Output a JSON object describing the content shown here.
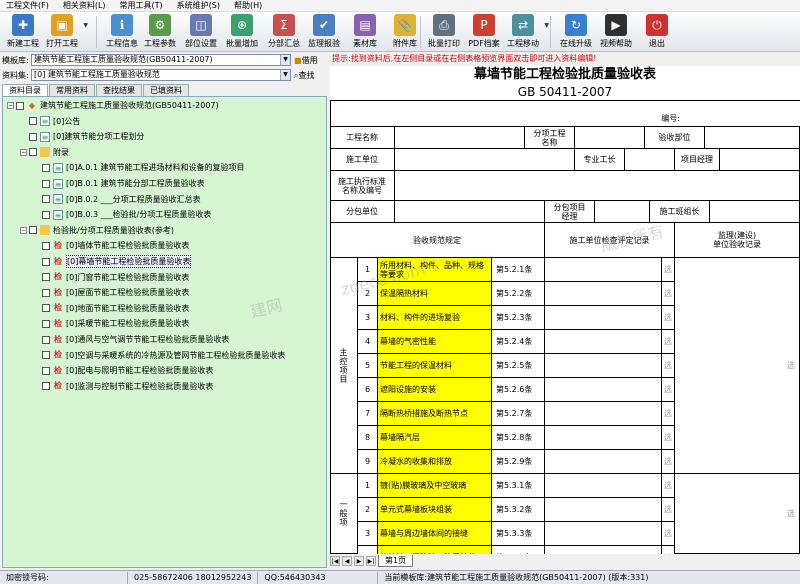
{
  "menu": [
    "工程文件(F)",
    "相关资料(L)",
    "常用工具(T)",
    "系统维护(S)",
    "帮助(H)"
  ],
  "toolbar": [
    {
      "label": "新建工程",
      "icon": "new-project-icon",
      "color": "#3a78c8"
    },
    {
      "label": "打开工程",
      "icon": "open-project-icon",
      "color": "#e0a020"
    },
    {
      "label": "工程信息",
      "icon": "project-info-icon",
      "color": "#4a90d0"
    },
    {
      "label": "工程参数",
      "icon": "project-params-icon",
      "color": "#5a9a4a"
    },
    {
      "label": "部位设置",
      "icon": "position-settings-icon",
      "color": "#6a7ab0"
    },
    {
      "label": "批量增加",
      "icon": "batch-add-icon",
      "color": "#3aa070"
    },
    {
      "label": "分部汇总",
      "icon": "summary-icon",
      "color": "#c85050"
    },
    {
      "label": "监理报验",
      "icon": "inspection-icon",
      "color": "#4a80c0"
    },
    {
      "label": "素材库",
      "icon": "material-library-icon",
      "color": "#8a60b0"
    },
    {
      "label": "附件库",
      "icon": "attachment-library-icon",
      "color": "#e0b030"
    },
    {
      "label": "批量打印",
      "icon": "batch-print-icon",
      "color": "#607080"
    },
    {
      "label": "PDF档案",
      "icon": "pdf-archive-icon",
      "color": "#d04030"
    },
    {
      "label": "工程移动",
      "icon": "project-move-icon",
      "color": "#4a90a0"
    },
    {
      "label": "在线升级",
      "icon": "online-upgrade-icon",
      "color": "#3a80d0"
    },
    {
      "label": "视频帮助",
      "icon": "video-help-icon",
      "color": "#303030"
    },
    {
      "label": "退出",
      "icon": "exit-icon",
      "color": "#d03030"
    }
  ],
  "template_lib": {
    "label": "模板库:",
    "value": "建筑节能工程施工质量验收规范(GB50411-2007)",
    "action": "借用"
  },
  "data_set": {
    "label": "资料集:",
    "value": "[0] 建筑节能工程施工质量验收规范",
    "action": "查找"
  },
  "left_tabs": [
    "资料目录",
    "常用资料",
    "查找结果",
    "已填资料"
  ],
  "tree": [
    {
      "level": 0,
      "type": "root",
      "text": "建筑节能工程施工质量验收规范(GB50411-2007)"
    },
    {
      "level": 1,
      "type": "doc",
      "text": "[0]公告"
    },
    {
      "level": 1,
      "type": "doc",
      "text": "[0]建筑节能分项工程划分"
    },
    {
      "level": 1,
      "type": "folder",
      "text": "附录"
    },
    {
      "level": 2,
      "type": "doc",
      "text": "[0]A.0.1 建筑节能工程进场材料和设备的复验项目"
    },
    {
      "level": 2,
      "type": "doc",
      "text": "[0]B.0.1 建筑节能分部工程质量验收表"
    },
    {
      "level": 2,
      "type": "doc",
      "text": "[0]B.0.2 ___分项工程质量验收汇总表"
    },
    {
      "level": 2,
      "type": "doc",
      "text": "[0]B.0.3 ___检验批/分项工程质量验收表"
    },
    {
      "level": 1,
      "type": "folder",
      "text": "检验批/分项工程质量验收表(参考)"
    },
    {
      "level": 2,
      "type": "sheet",
      "text": "[0]墙体节能工程检验批质量验收表"
    },
    {
      "level": 2,
      "type": "sheet",
      "text": "[0]幕墙节能工程检验批质量验收表",
      "selected": true
    },
    {
      "level": 2,
      "type": "sheet",
      "text": "[0]门窗节能工程检验批质量验收表"
    },
    {
      "level": 2,
      "type": "sheet",
      "text": "[0]屋面节能工程检验批质量验收表"
    },
    {
      "level": 2,
      "type": "sheet",
      "text": "[0]地面节能工程检验批质量验收表"
    },
    {
      "level": 2,
      "type": "sheet",
      "text": "[0]采暖节能工程检验批质量验收表"
    },
    {
      "level": 2,
      "type": "sheet",
      "text": "[0]通风与空气调节节能工程检验批质量验收表"
    },
    {
      "level": 2,
      "type": "sheet",
      "text": "[0]空调与采暖系统的冷热源及管网节能工程检验批质量验收表"
    },
    {
      "level": 2,
      "type": "sheet",
      "text": "[0]配电与照明节能工程检验批质量验收表"
    },
    {
      "level": 2,
      "type": "sheet",
      "text": "[0]监测与控制节能工程检验批质量验收表"
    }
  ],
  "hint": "提示:找到资料后,在左侧目录或在右侧表格预览界面双击即可进入资料编辑!",
  "form": {
    "title": "幕墙节能工程检验批质量验收表",
    "subtitle": "GB 50411-2007",
    "number_label": "编号:",
    "row1": [
      "工程名称",
      "分项工程\n名称",
      "验收部位"
    ],
    "row2": [
      "施工单位",
      "专业工长",
      "项目经理"
    ],
    "row3": "施工执行标准\n名称及编号",
    "row4": [
      "分包单位",
      "分包项目\n经理",
      "施工班组长"
    ],
    "header": [
      "验收规范规定",
      "施工单位检查评定记录",
      "监理(建设)\n单位验收记录"
    ],
    "main_group": "主\n控\n项\n目",
    "general_group": "一\n般\n项",
    "pick": "选",
    "main_items": [
      {
        "no": "1",
        "text": "所用材料、构件、品种、规格等要求",
        "clause": "第5.2.1条"
      },
      {
        "no": "2",
        "text": "保温隔热材料",
        "clause": "第5.2.2条"
      },
      {
        "no": "3",
        "text": "材料、构件的进场复验",
        "clause": "第5.2.3条"
      },
      {
        "no": "4",
        "text": "幕墙的气密性能",
        "clause": "第5.2.4条"
      },
      {
        "no": "5",
        "text": "节能工程的保温材料",
        "clause": "第5.2.5条"
      },
      {
        "no": "6",
        "text": "遮阳设施的安装",
        "clause": "第5.2.6条"
      },
      {
        "no": "7",
        "text": "隔断热桥措施及断热节点",
        "clause": "第5.2.7条"
      },
      {
        "no": "8",
        "text": "幕墙隔汽层",
        "clause": "第5.2.8条"
      },
      {
        "no": "9",
        "text": "冷凝水的收集和排放",
        "clause": "第5.2.9条"
      }
    ],
    "general_items": [
      {
        "no": "1",
        "text": "镀(贴)膜玻璃及中空玻璃",
        "clause": "第5.3.1条"
      },
      {
        "no": "2",
        "text": "单元式幕墙板块组装",
        "clause": "第5.3.2条"
      },
      {
        "no": "3",
        "text": "幕墙与周边墙体间的接缝",
        "clause": "第5.3.3条"
      },
      {
        "no": "4",
        "text": "伸缩缝、沉降缝、抗震缝的",
        "clause": "第5.3.4条"
      }
    ]
  },
  "sheet_tab": "第1页",
  "status": {
    "lock_label": "加密锁号码:",
    "phone": "025-58672406 18012952243",
    "qq": "QQ:546430343",
    "current": "当前模板库:建筑节能工程施工质量验收规范(GB50411-2007) (版本:331)"
  },
  "watermarks": [
    "zgeca.com",
    "建网",
    "版权所有"
  ]
}
